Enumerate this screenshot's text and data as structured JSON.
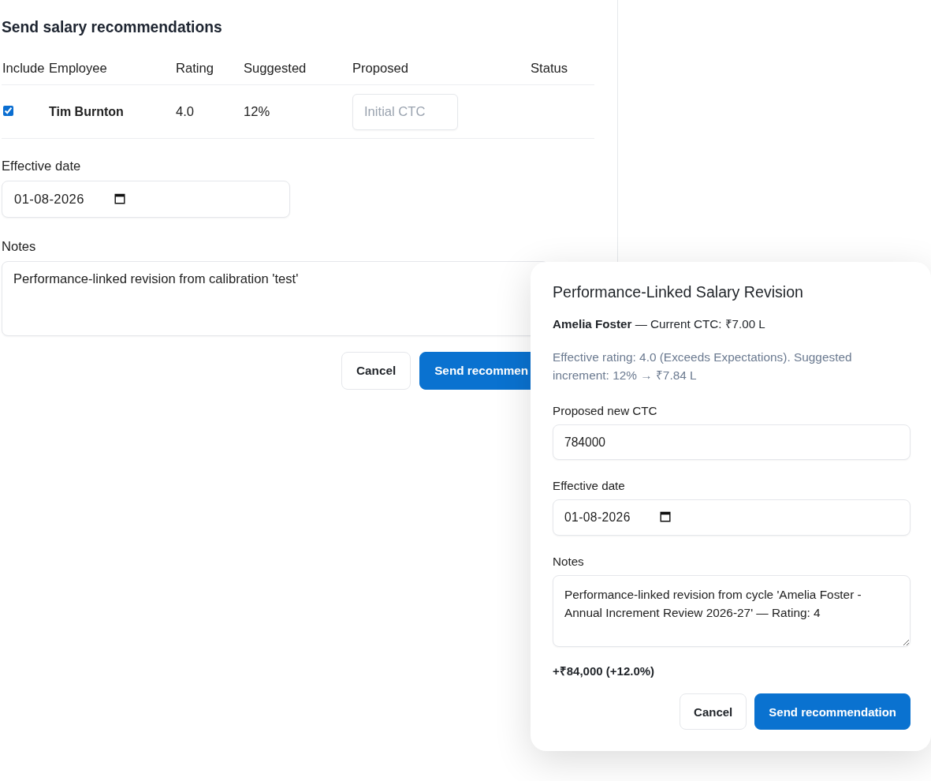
{
  "panel": {
    "title": "Send salary recommendations",
    "table": {
      "columns": [
        "Include",
        "Employee",
        "Rating",
        "Suggested",
        "Proposed",
        "Status"
      ],
      "rows": [
        {
          "include": true,
          "employee": "Tim Burnton",
          "rating": "4.0",
          "suggested": "12%",
          "proposed": {
            "placeholder": "Initial CTC"
          }
        }
      ]
    },
    "effective_date": {
      "label": "Effective date",
      "value": "01-08-2026"
    },
    "notes": {
      "label": "Notes",
      "value": "Performance-linked revision from calibration 'test'"
    },
    "buttons": [
      {
        "label": "Cancel",
        "kind": "secondary"
      },
      {
        "label": "Send recommen",
        "kind": "primary"
      }
    ]
  },
  "dialog": {
    "title": "Performance-Linked Salary Revision",
    "summary": "**Amelia Foster** — Current CTC: ₹7.00 L",
    "hint": "Effective rating: 4.0 (Exceeds Expectations). Suggested increment: 12% → ₹7.84 L",
    "proposed_ctc": {
      "label": "Proposed new CTC",
      "value": "784000"
    },
    "effective_date": {
      "label": "Effective date",
      "value": "01-08-2026"
    },
    "notes": {
      "label": "Notes",
      "value": "Performance-linked revision from cycle 'Amelia Foster - Annual Increment Review 2026-27' — Rating: 4"
    },
    "difference": "+₹84,000 (+12.0%)",
    "buttons": [
      {
        "label": "Cancel",
        "kind": "secondary"
      },
      {
        "label": "Send recommendation",
        "kind": "primary"
      }
    ]
  }
}
